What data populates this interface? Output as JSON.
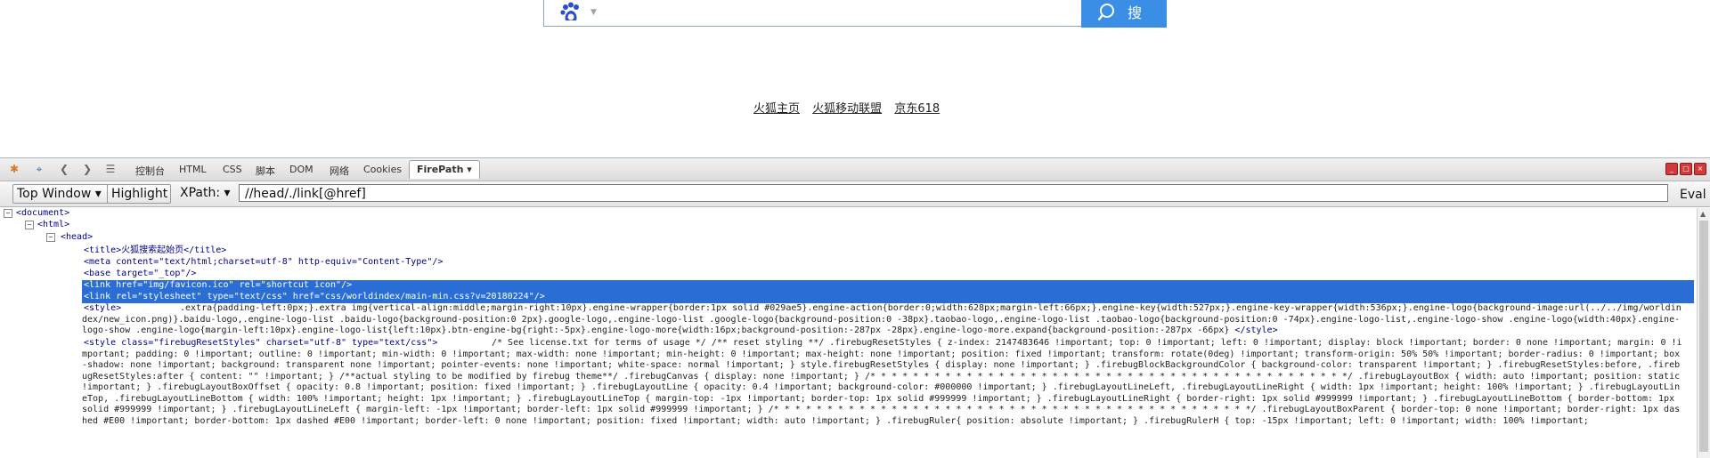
{
  "page": {
    "search_button_label": "搜 索",
    "links": [
      "火狐主页",
      "火狐移动联盟",
      "京东618"
    ]
  },
  "firebug": {
    "tabs": [
      "控制台",
      "HTML",
      "CSS",
      "脚本",
      "DOM",
      "网络",
      "Cookies",
      "FirePath"
    ],
    "active_tab": "FirePath",
    "top_window_label": "Top Window",
    "highlight_label": "Highlight",
    "xpath_label": "XPath:",
    "xpath_value": "//head/./link[@href]",
    "eval_label": "Eval",
    "tree": {
      "document": "<document>",
      "html": "<html>",
      "head": "<head>",
      "title_line": "<title>火狐搜索起始页</title>",
      "meta_line": "<meta content=\"text/html;charset=utf-8\" http-equiv=\"Content-Type\"/>",
      "base_line": "<base target=\"_top\"/>",
      "link1_line": "<link href=\"img/favicon.ico\" rel=\"shortcut icon\"/>",
      "link2_line": "<link rel=\"stylesheet\" type=\"text/css\" href=\"css/worldindex/main-min.css?v=20180224\"/>",
      "style1_open": "<style>",
      "style1_text": ".extra{padding-left:0px;}.extra img{vertical-align:middle;margin-right:10px}.engine-wrapper{border:1px solid #029ae5}.engine-action{border:0;width:628px;margin-left:66px;}.engine-key{width:527px;}.engine-key-wrapper{width:536px;}.engine-logo{background-image:url(../../img/worldindex/new_icon.png)}.baidu-logo,.engine-logo-list .baidu-logo{background-position:0 2px}.google-logo,.engine-logo-list .google-logo{background-position:0 -38px}.taobao-logo,.engine-logo-list .taobao-logo{background-position:0 -74px}.engine-logo-list,.engine-logo-show .engine-logo{width:40px}.engine-logo-show .engine-logo{margin-left:10px}.engine-logo-list{left:10px}.btn-engine-bg{right:-5px}.engine-logo-more{width:16px;background-position:-287px -28px}.engine-logo-more.expand{background-position:-287px -66px}",
      "style1_close": "</style>",
      "style2_open": "<style class=\"firebugResetStyles\" charset=\"utf-8\" type=\"text/css\">",
      "style2_text": "/* See license.txt for terms of usage */ /** reset styling **/ .firebugResetStyles { z-index: 2147483646 !important; top: 0 !important; left: 0 !important; display: block !important; border: 0 none !important; margin: 0 !important; padding: 0 !important; outline: 0 !important; min-width: 0 !important; max-width: none !important; min-height: 0 !important; max-height: none !important; position: fixed !important; transform: rotate(0deg) !important; transform-origin: 50% 50% !important; border-radius: 0 !important; box-shadow: none !important; background: transparent none !important; pointer-events: none !important; white-space: normal !important; } style.firebugResetStyles { display: none !important; } .firebugBlockBackgroundColor { background-color: transparent !important; } .firebugResetStyles:before, .firebugResetStyles:after { content: \"\" !important; } /**actual styling to be modified by firebug theme**/ .firebugCanvas { display: none !important; } /* * * * * * * * * * * * * * * * * * * * * * * * * * * * * * * * * * * * * * * * * * * * */ .firebugLayoutBox { width: auto !important; position: static !important; } .firebugLayoutBoxOffset { opacity: 0.8 !important; position: fixed !important; } .firebugLayoutLine { opacity: 0.4 !important; background-color: #000000 !important; } .firebugLayoutLineLeft, .firebugLayoutLineRight { width: 1px !important; height: 100% !important; } .firebugLayoutLineTop, .firebugLayoutLineBottom { width: 100% !important; height: 1px !important; } .firebugLayoutLineTop { margin-top: -1px !important; border-top: 1px solid #999999 !important; } .firebugLayoutLineRight { border-right: 1px solid #999999 !important; } .firebugLayoutLineBottom { border-bottom: 1px solid #999999 !important; } .firebugLayoutLineLeft { margin-left: -1px !important; border-left: 1px solid #999999 !important; } /* * * * * * * * * * * * * * * * * * * * * * * * * * * * * * * * * * * * * * * * * * * * */ .firebugLayoutBoxParent { border-top: 0 none !important; border-right: 1px dashed #E00 !important; border-bottom: 1px dashed #E00 !important; border-left: 0 none !important; position: fixed !important; width: auto !important; } .firebugRuler{ position: absolute !important; } .firebugRulerH { top: -15px !important; left: 0 !important; width: 100% !important;"
    }
  },
  "colors": {
    "highlight": "#2a6ed5",
    "search_button": "#3a8ee6",
    "tag": "#000088",
    "attr_value": "#aa0000"
  }
}
